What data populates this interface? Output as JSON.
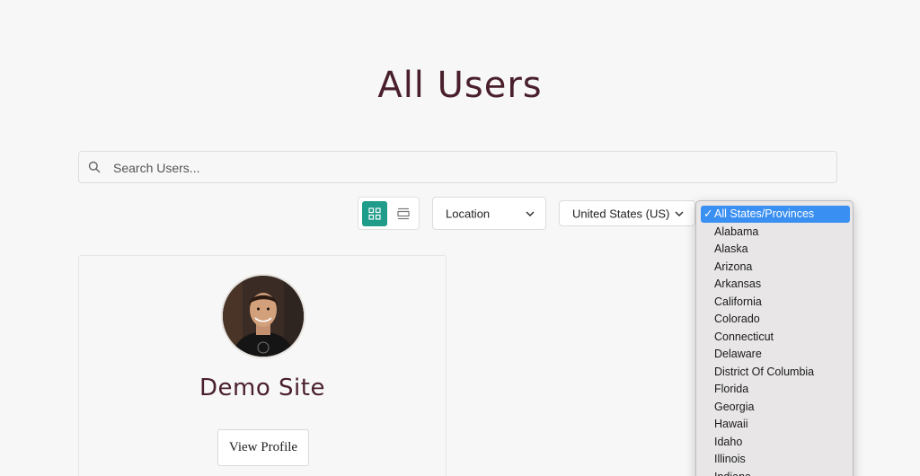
{
  "page": {
    "title": "All Users"
  },
  "search": {
    "placeholder": "Search Users..."
  },
  "filters": {
    "location_label": "Location",
    "country_label": "United States (US)"
  },
  "view_toggle": {
    "active": "grid"
  },
  "states_dropdown": {
    "check": "✓",
    "selected_index": 0,
    "options": [
      "All States/Provinces",
      "Alabama",
      "Alaska",
      "Arizona",
      "Arkansas",
      "California",
      "Colorado",
      "Connecticut",
      "Delaware",
      "District Of Columbia",
      "Florida",
      "Georgia",
      "Hawaii",
      "Idaho",
      "Illinois",
      "Indiana"
    ]
  },
  "users": [
    {
      "name": "Demo Site",
      "button_label": "View Profile"
    }
  ],
  "colors": {
    "title": "#4a1f2c",
    "accent_teal": "#1f9c8a",
    "selected_option": "#3a8ff2",
    "page_background": "#f7f7f7"
  },
  "icons": {
    "search": "search-icon",
    "grid_view": "grid-view-icon",
    "list_view": "list-view-icon",
    "chevron": "chevron-down-icon",
    "check": "checkmark-icon"
  }
}
